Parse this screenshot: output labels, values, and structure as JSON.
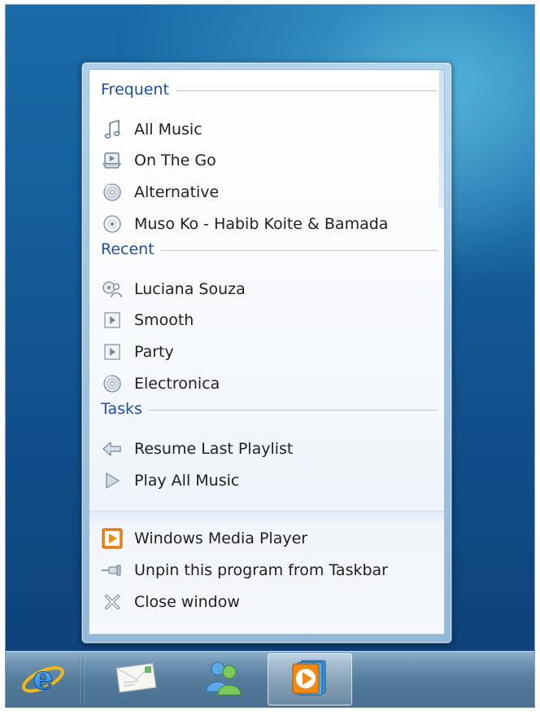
{
  "jumplist": {
    "sections": [
      {
        "title": "Frequent",
        "items": [
          {
            "label": "All Music",
            "icon": "music-note-icon"
          },
          {
            "label": "On The Go",
            "icon": "portable-player-icon"
          },
          {
            "label": "Alternative",
            "icon": "genre-disc-icon"
          },
          {
            "label": "Muso Ko - Habib Koite & Bamada",
            "icon": "album-cd-icon"
          }
        ]
      },
      {
        "title": "Recent",
        "items": [
          {
            "label": "Luciana Souza",
            "icon": "artist-icon"
          },
          {
            "label": "Smooth",
            "icon": "playlist-icon"
          },
          {
            "label": "Party",
            "icon": "playlist-icon"
          },
          {
            "label": "Electronica",
            "icon": "genre-disc-icon"
          }
        ]
      },
      {
        "title": "Tasks",
        "items": [
          {
            "label": "Resume Last Playlist",
            "icon": "back-arrow-icon"
          },
          {
            "label": "Play All Music",
            "icon": "play-triangle-icon"
          }
        ]
      }
    ],
    "program_items": [
      {
        "label": "Windows Media Player",
        "icon": "wmp-icon"
      },
      {
        "label": "Unpin this program from Taskbar",
        "icon": "pin-icon"
      },
      {
        "label": "Close window",
        "icon": "close-icon"
      }
    ]
  },
  "taskbar": {
    "buttons": [
      {
        "name": "internet-explorer-icon"
      },
      {
        "name": "mail-icon"
      },
      {
        "name": "messenger-icon"
      },
      {
        "name": "windows-media-player-icon",
        "active": true
      }
    ]
  },
  "colors": {
    "section_title": "#1e4fa3",
    "desktop": "#155f9c",
    "wmp_orange": "#f08a12"
  }
}
